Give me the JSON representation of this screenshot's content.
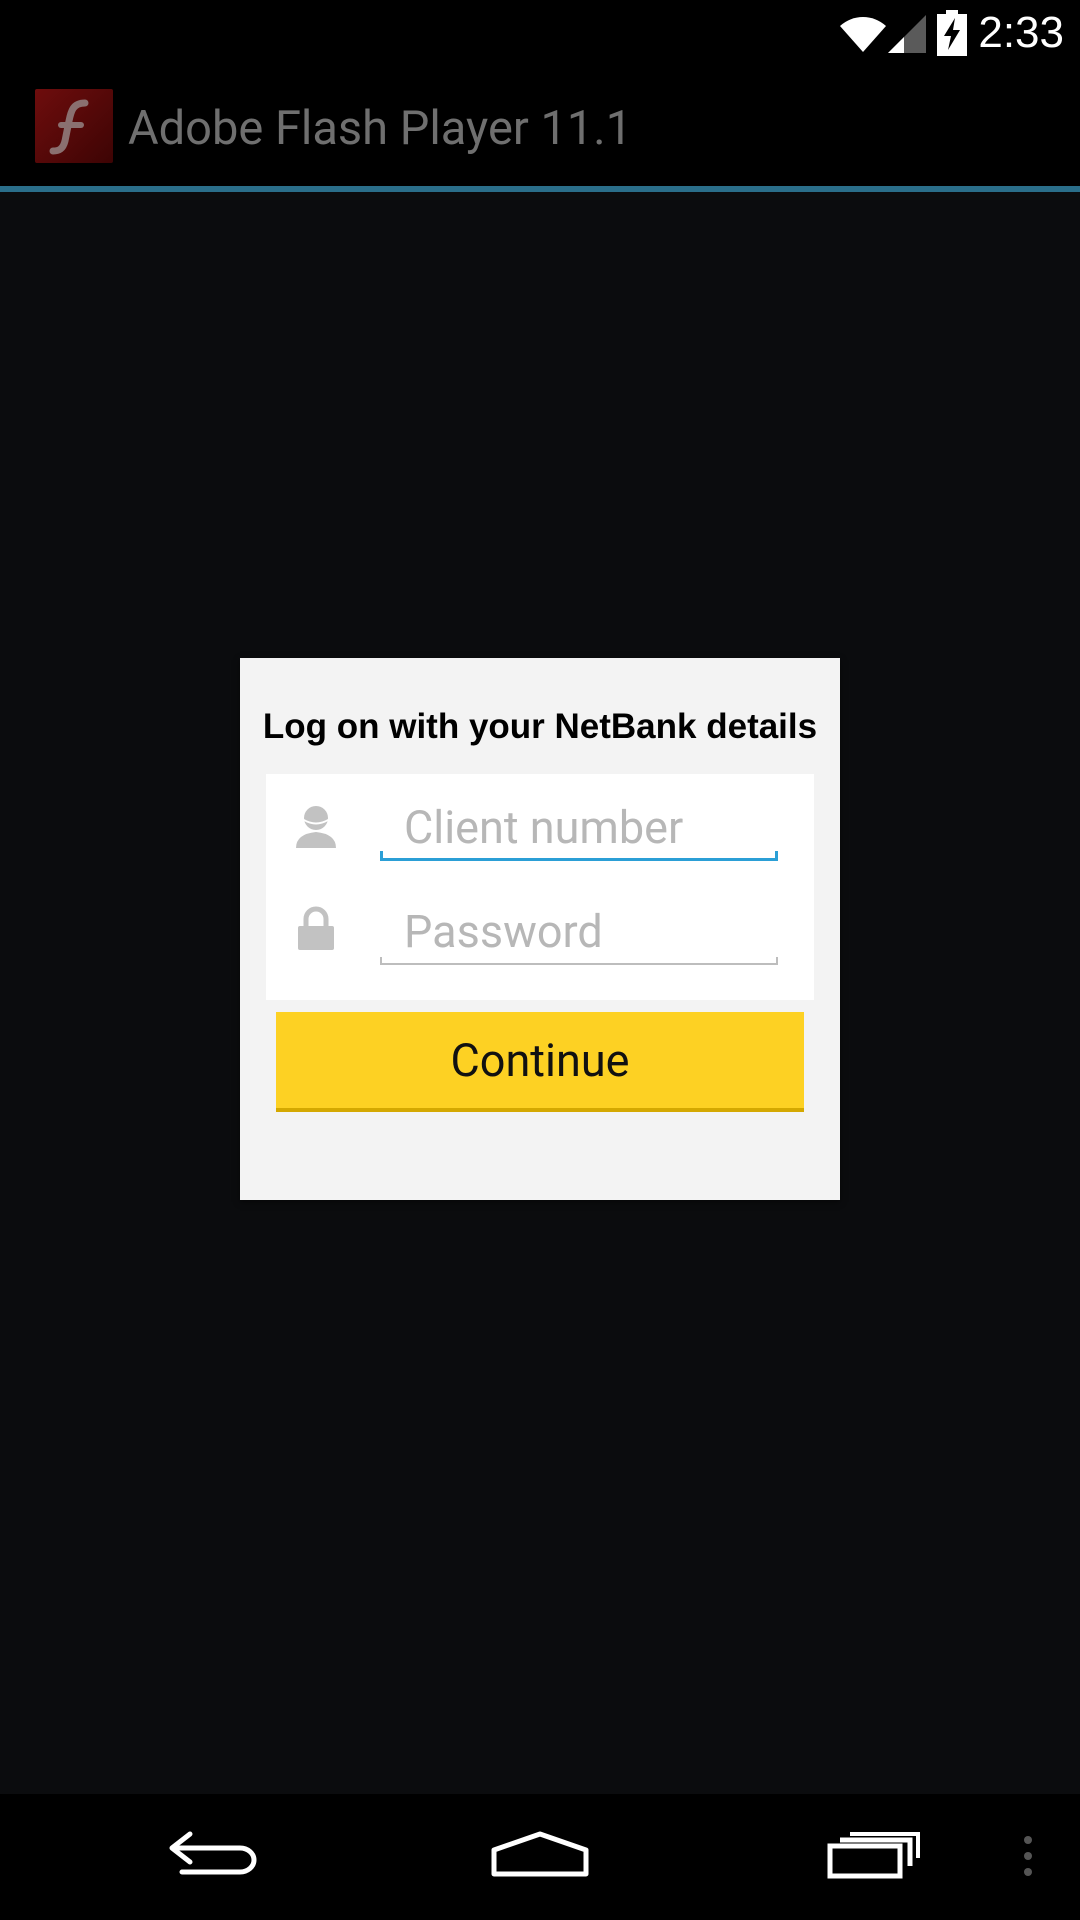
{
  "status_bar": {
    "time": "2:33",
    "icons": [
      "wifi-icon",
      "cell-signal-icon",
      "battery-charging-icon"
    ]
  },
  "action_bar": {
    "app_icon": "flash-player-icon",
    "title": "Adobe Flash Player 11.1"
  },
  "dialog": {
    "title": "Log on with your NetBank details",
    "fields": [
      {
        "icon": "user-icon",
        "placeholder": "Client number",
        "value": ""
      },
      {
        "icon": "lock-icon",
        "placeholder": "Password",
        "value": ""
      }
    ],
    "continue_label": "Continue"
  },
  "nav_bar": {
    "buttons": [
      "back-icon",
      "home-icon",
      "recent-apps-icon",
      "overflow-menu-icon"
    ]
  },
  "colors": {
    "action_bar_divider": "#2a6e8a",
    "focused_underline": "#2b9fd6",
    "button": "#fdd123",
    "dialog_background": "#f3f3f3"
  }
}
